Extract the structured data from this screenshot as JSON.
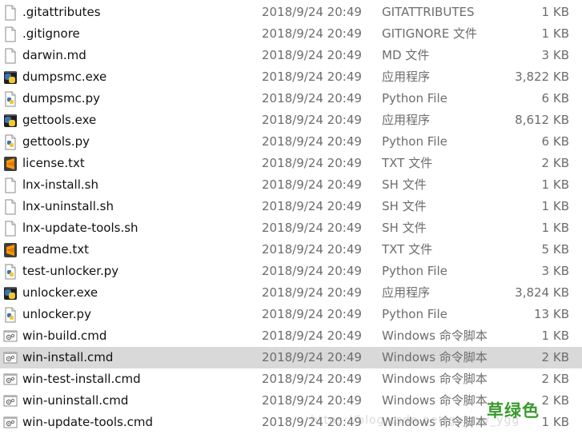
{
  "files": [
    {
      "name": ".gitattributes",
      "date": "2018/9/24 20:49",
      "type": "GITATTRIBUTES",
      "size": "1 KB",
      "icon": "blank-file-icon"
    },
    {
      "name": ".gitignore",
      "date": "2018/9/24 20:49",
      "type": "GITIGNORE 文件",
      "size": "1 KB",
      "icon": "blank-file-icon"
    },
    {
      "name": "darwin.md",
      "date": "2018/9/24 20:49",
      "type": "MD 文件",
      "size": "3 KB",
      "icon": "blank-file-icon"
    },
    {
      "name": "dumpsmc.exe",
      "date": "2018/9/24 20:49",
      "type": "应用程序",
      "size": "3,822 KB",
      "icon": "python-exe-icon"
    },
    {
      "name": "dumpsmc.py",
      "date": "2018/9/24 20:49",
      "type": "Python File",
      "size": "6 KB",
      "icon": "python-file-icon"
    },
    {
      "name": "gettools.exe",
      "date": "2018/9/24 20:49",
      "type": "应用程序",
      "size": "8,612 KB",
      "icon": "python-exe-icon"
    },
    {
      "name": "gettools.py",
      "date": "2018/9/24 20:49",
      "type": "Python File",
      "size": "6 KB",
      "icon": "python-file-icon"
    },
    {
      "name": "license.txt",
      "date": "2018/9/24 20:49",
      "type": "TXT 文件",
      "size": "2 KB",
      "icon": "sublime-text-icon"
    },
    {
      "name": "lnx-install.sh",
      "date": "2018/9/24 20:49",
      "type": "SH 文件",
      "size": "1 KB",
      "icon": "blank-file-icon"
    },
    {
      "name": "lnx-uninstall.sh",
      "date": "2018/9/24 20:49",
      "type": "SH 文件",
      "size": "1 KB",
      "icon": "blank-file-icon"
    },
    {
      "name": "lnx-update-tools.sh",
      "date": "2018/9/24 20:49",
      "type": "SH 文件",
      "size": "1 KB",
      "icon": "blank-file-icon"
    },
    {
      "name": "readme.txt",
      "date": "2018/9/24 20:49",
      "type": "TXT 文件",
      "size": "5 KB",
      "icon": "sublime-text-icon"
    },
    {
      "name": "test-unlocker.py",
      "date": "2018/9/24 20:49",
      "type": "Python File",
      "size": "3 KB",
      "icon": "python-file-icon"
    },
    {
      "name": "unlocker.exe",
      "date": "2018/9/24 20:49",
      "type": "应用程序",
      "size": "3,824 KB",
      "icon": "python-exe-icon"
    },
    {
      "name": "unlocker.py",
      "date": "2018/9/24 20:49",
      "type": "Python File",
      "size": "13 KB",
      "icon": "python-file-icon"
    },
    {
      "name": "win-build.cmd",
      "date": "2018/9/24 20:49",
      "type": "Windows 命令脚本",
      "size": "1 KB",
      "icon": "cmd-script-icon"
    },
    {
      "name": "win-install.cmd",
      "date": "2018/9/24 20:49",
      "type": "Windows 命令脚本",
      "size": "2 KB",
      "icon": "cmd-script-icon",
      "selected": true
    },
    {
      "name": "win-test-install.cmd",
      "date": "2018/9/24 20:49",
      "type": "Windows 命令脚本",
      "size": "2 KB",
      "icon": "cmd-script-icon"
    },
    {
      "name": "win-uninstall.cmd",
      "date": "2018/9/24 20:49",
      "type": "Windows 命令脚本",
      "size": "2 KB",
      "icon": "cmd-script-icon"
    },
    {
      "name": "win-update-tools.cmd",
      "date": "2018/9/24 20:49",
      "type": "Windows 命令脚本",
      "size": "1 KB",
      "icon": "cmd-script-icon"
    }
  ],
  "watermark": {
    "text": "https://blog.csdn.net/galaxy_ygg",
    "logo": "草绿色"
  },
  "colors": {
    "selected_row": "#d9d9d9",
    "name_text": "#111111",
    "meta_text": "#6d6d6d",
    "logo_green": "#3a9a2e"
  }
}
